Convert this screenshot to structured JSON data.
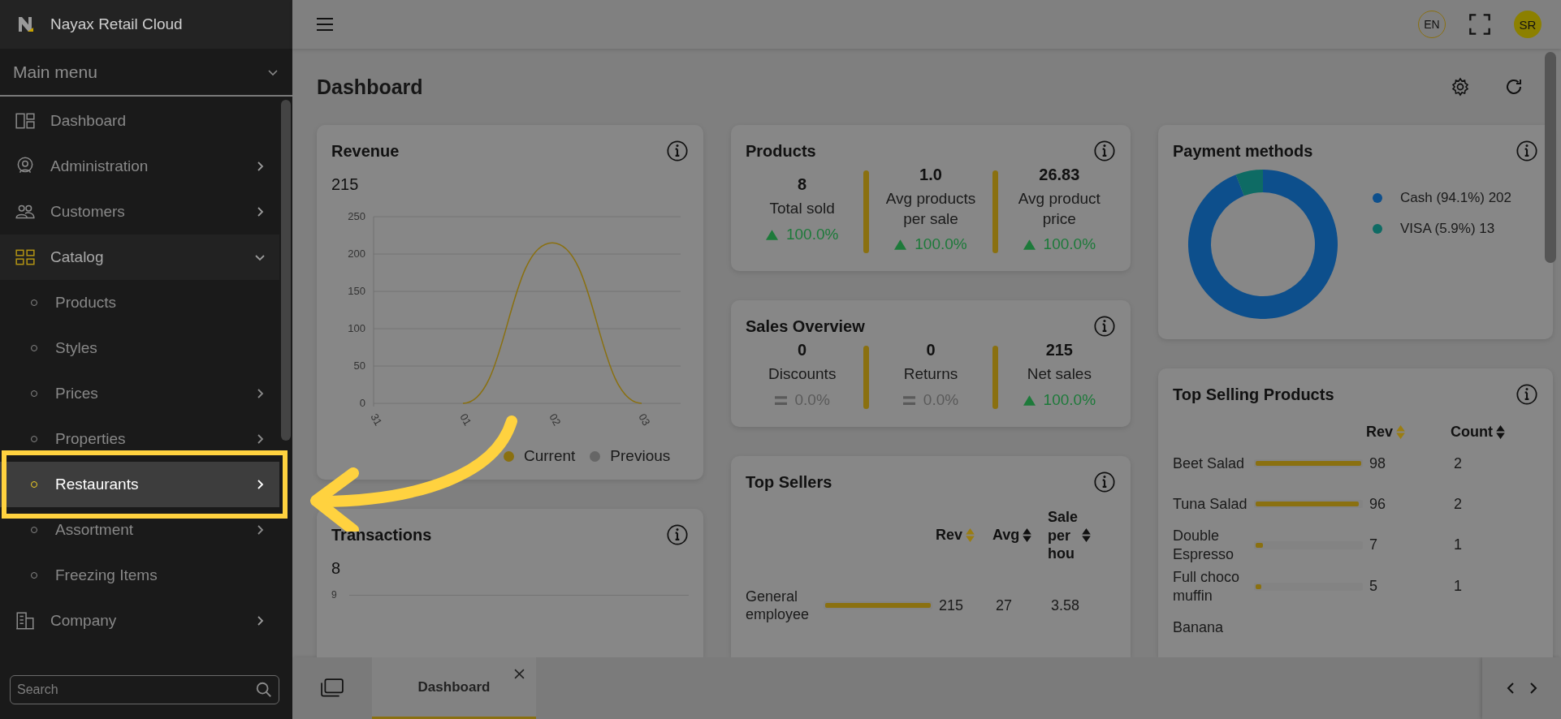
{
  "app": {
    "title": "Nayax Retail Cloud"
  },
  "sidebar": {
    "menu_title": "Main menu",
    "items": [
      {
        "label": "Dashboard",
        "kind": "dashboard",
        "has_submenu": false,
        "expanded": false,
        "selected": false
      },
      {
        "label": "Administration",
        "kind": "admin",
        "has_submenu": true,
        "expanded": false,
        "selected": false
      },
      {
        "label": "Customers",
        "kind": "customers",
        "has_submenu": true,
        "expanded": false,
        "selected": false
      },
      {
        "label": "Catalog",
        "kind": "catalog",
        "has_submenu": true,
        "expanded": true,
        "selected": false,
        "children": [
          {
            "label": "Products",
            "has_submenu": false,
            "selected": false
          },
          {
            "label": "Styles",
            "has_submenu": false,
            "selected": false
          },
          {
            "label": "Prices",
            "has_submenu": true,
            "selected": false
          },
          {
            "label": "Properties",
            "has_submenu": true,
            "selected": false
          },
          {
            "label": "Restaurants",
            "has_submenu": true,
            "selected": true
          },
          {
            "label": "Assortment",
            "has_submenu": true,
            "selected": false
          },
          {
            "label": "Freezing Items",
            "has_submenu": false,
            "selected": false
          }
        ]
      },
      {
        "label": "Company",
        "kind": "company",
        "has_submenu": true,
        "expanded": false,
        "selected": false
      }
    ],
    "search": {
      "placeholder": "Search"
    }
  },
  "topbar": {
    "language": "EN",
    "user_initials": "SR"
  },
  "page": {
    "title": "Dashboard"
  },
  "revenue": {
    "title": "Revenue",
    "total": "215",
    "chart_data": {
      "type": "line",
      "grid": true,
      "categories": [
        "31",
        "01",
        "02",
        "03"
      ],
      "series": [
        {
          "name": "Current",
          "color": "#8a7010",
          "values": [
            null,
            0,
            215,
            0
          ]
        },
        {
          "name": "Previous",
          "color": "#666666",
          "values": [
            null,
            null,
            null,
            null
          ]
        }
      ],
      "ylim": [
        0,
        250
      ],
      "yticks": [
        0,
        50,
        100,
        150,
        200,
        250
      ]
    }
  },
  "transactions": {
    "title": "Transactions",
    "total": "8",
    "axis_tick": "9"
  },
  "products": {
    "title": "Products",
    "metrics": [
      {
        "value": "8",
        "label": "Total sold",
        "change": "100.0%",
        "kind": "up"
      },
      {
        "value": "1.0",
        "label": "Avg products per sale",
        "change": "100.0%",
        "kind": "up"
      },
      {
        "value": "26.83",
        "label": "Avg product price",
        "change": "100.0%",
        "kind": "up"
      }
    ]
  },
  "sales_overview": {
    "title": "Sales Overview",
    "metrics": [
      {
        "value": "0",
        "label": "Discounts",
        "change": "0.0%",
        "kind": "flat"
      },
      {
        "value": "0",
        "label": "Returns",
        "change": "0.0%",
        "kind": "flat"
      },
      {
        "value": "215",
        "label": "Net sales",
        "change": "100.0%",
        "kind": "up"
      }
    ]
  },
  "top_sellers": {
    "title": "Top Sellers",
    "columns": [
      {
        "label": "Rev",
        "sorted": true
      },
      {
        "label": "Avg",
        "sorted": false
      },
      {
        "label": "Sale per hou",
        "sorted": false
      }
    ],
    "rows": [
      {
        "name": "General employee",
        "level": 1,
        "cells": [
          "215",
          "27",
          "3.58"
        ]
      }
    ]
  },
  "payment_methods": {
    "title": "Payment methods",
    "legend": [
      {
        "detail": "(94.1%) 202",
        "color": "#0d4f8c"
      },
      {
        "detail": "(5.9%) 13",
        "color": "#0e6b64"
      }
    ],
    "chart_data": {
      "type": "donut",
      "categories": [
        "Cash",
        "VISA"
      ],
      "values": [
        94.1,
        5.9
      ]
    }
  },
  "top_selling_products": {
    "title": "Top Selling Products",
    "columns": [
      {
        "label": "Rev",
        "sorted": true
      },
      {
        "label": "Count",
        "sorted": false
      }
    ],
    "rows": [
      {
        "name": "Beet Salad",
        "level": 1,
        "cells": [
          "98",
          "2"
        ]
      },
      {
        "name": "Tuna Salad",
        "level": 0.98,
        "cells": [
          "96",
          "2"
        ]
      },
      {
        "name": "Double Espresso",
        "level": 0.07,
        "cells": [
          "7",
          "1"
        ]
      },
      {
        "name": "Full choco muffin",
        "level": 0.05,
        "cells": [
          "5",
          "1"
        ]
      },
      {
        "name": "Banana"
      }
    ]
  },
  "bottom_tabs": [
    {
      "label": "Dashboard",
      "selected": true
    }
  ]
}
